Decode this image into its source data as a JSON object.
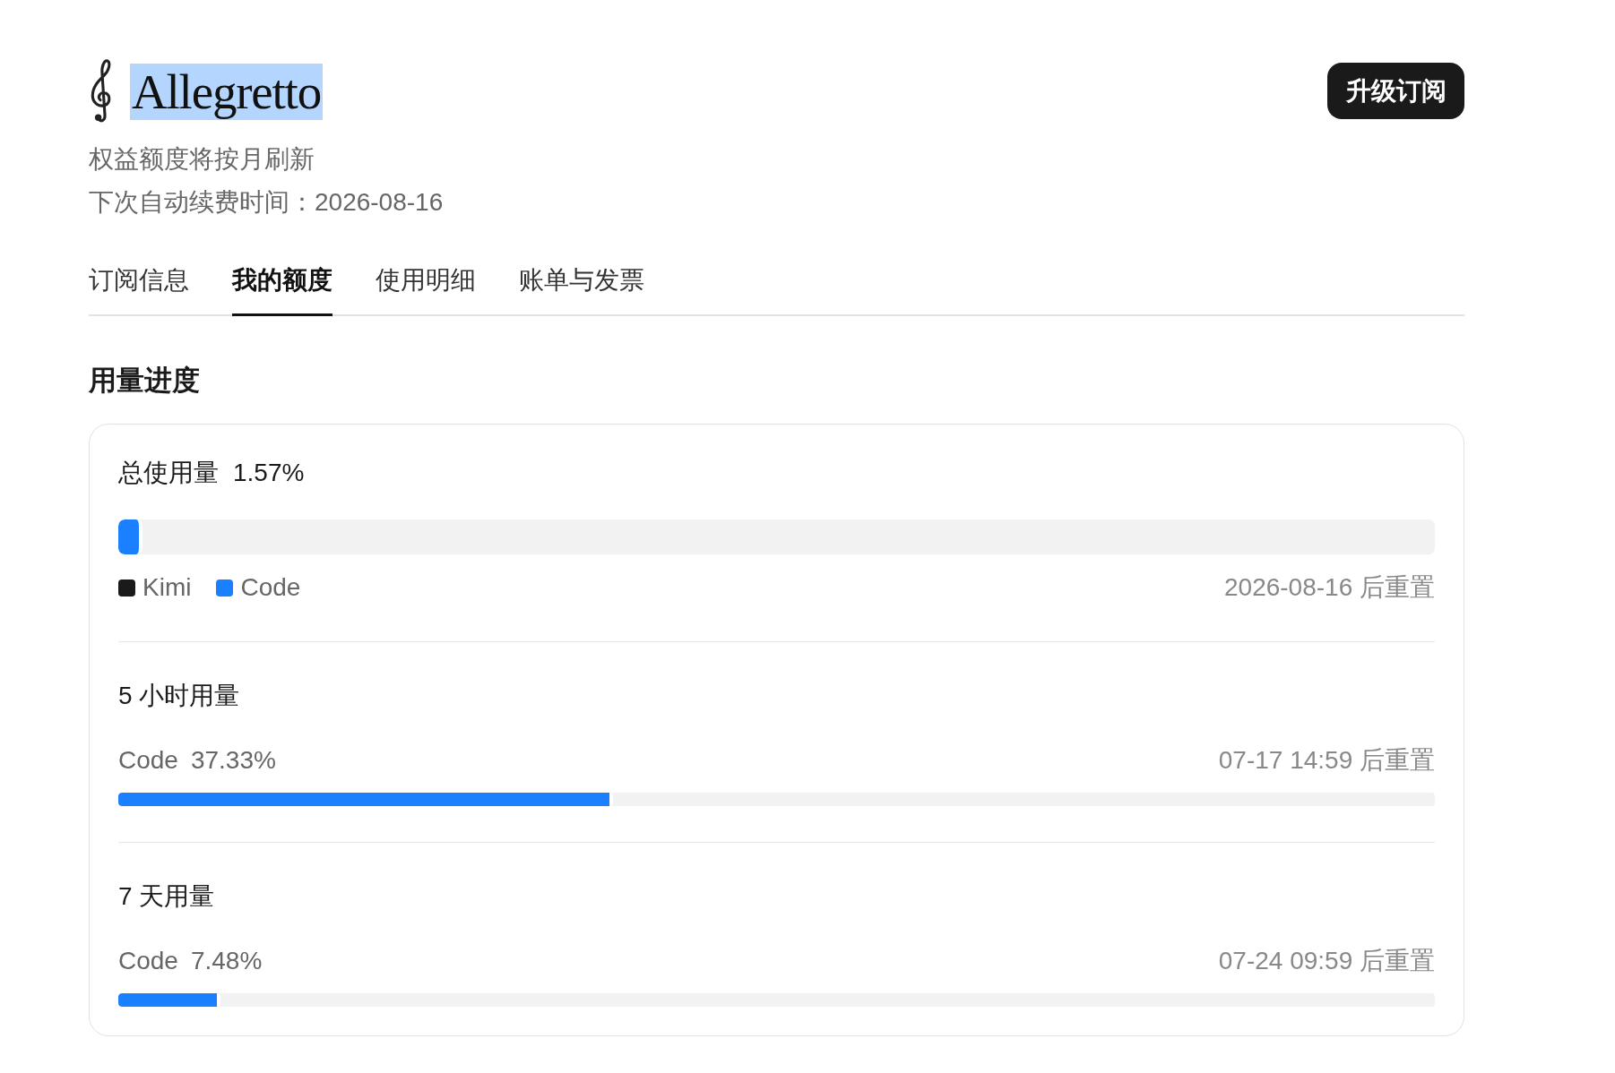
{
  "header": {
    "title": {
      "text": "Allegretto",
      "highlighted": true
    },
    "subtitle": "权益额度将按月刷新",
    "renewal": "下次自动续费时间：2026-08-16",
    "upgrade_button": "升级订阅"
  },
  "tabs": [
    {
      "label": "订阅信息",
      "selected": false
    },
    {
      "label": "我的额度",
      "selected": true
    },
    {
      "label": "使用明细",
      "selected": false
    },
    {
      "label": "账单与发票",
      "selected": false
    }
  ],
  "section_title": "用量进度",
  "usage": [
    {
      "kind": "stacked",
      "label": "总使用量",
      "percent": "1.57%",
      "segments": [
        {
          "color": "#1a80ff",
          "level": 0.0157
        }
      ],
      "legend": [
        {
          "label": "Kimi",
          "color": "#1a1a1a"
        },
        {
          "label": "Code",
          "color": "#1a80ff"
        }
      ],
      "reset": "2026-08-16 后重置"
    },
    {
      "kind": "single",
      "label": "5 小时用量",
      "product": "Code",
      "percent": "37.33%",
      "level": 0.3733,
      "reset": "07-17 14:59 后重置"
    },
    {
      "kind": "single",
      "label": "7 天用量",
      "product": "Code",
      "percent": "7.48%",
      "level": 0.0748,
      "reset": "07-24 09:59 后重置"
    }
  ]
}
